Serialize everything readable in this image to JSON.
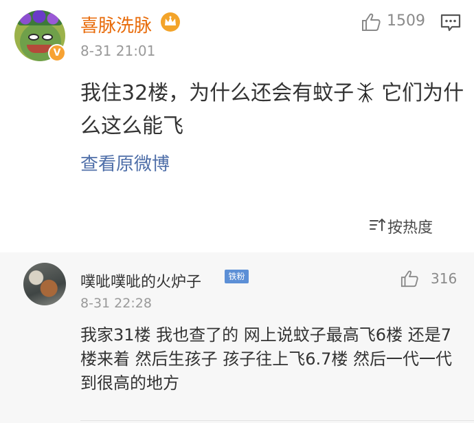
{
  "post": {
    "username": "喜脉洗脉",
    "timestamp": "8-31 21:01",
    "like_count": "1509",
    "text_before": "我住32楼，为什么还会有蚊子",
    "text_after": "它们为什么这么能飞",
    "view_original": "查看原微博",
    "verified_badge": "V",
    "name_color": "#e86b0a"
  },
  "sort": {
    "label": "按热度"
  },
  "reply": {
    "username": "噗呲噗呲的火炉子",
    "fan_badge": "铁粉",
    "timestamp": "8-31 22:28",
    "like_count": "316",
    "text": "我家31楼 我也查了的 网上说蚊子最高飞6楼 还是7楼来着 然后生孩子 孩子往上飞6.7楼 然后一代一代到很高的地方"
  },
  "icons": {
    "crown": "crown-icon",
    "like": "thumbs-up-icon",
    "more": "comment-menu-icon",
    "mosquito": "mosquito-icon",
    "sort": "sort-icon"
  }
}
